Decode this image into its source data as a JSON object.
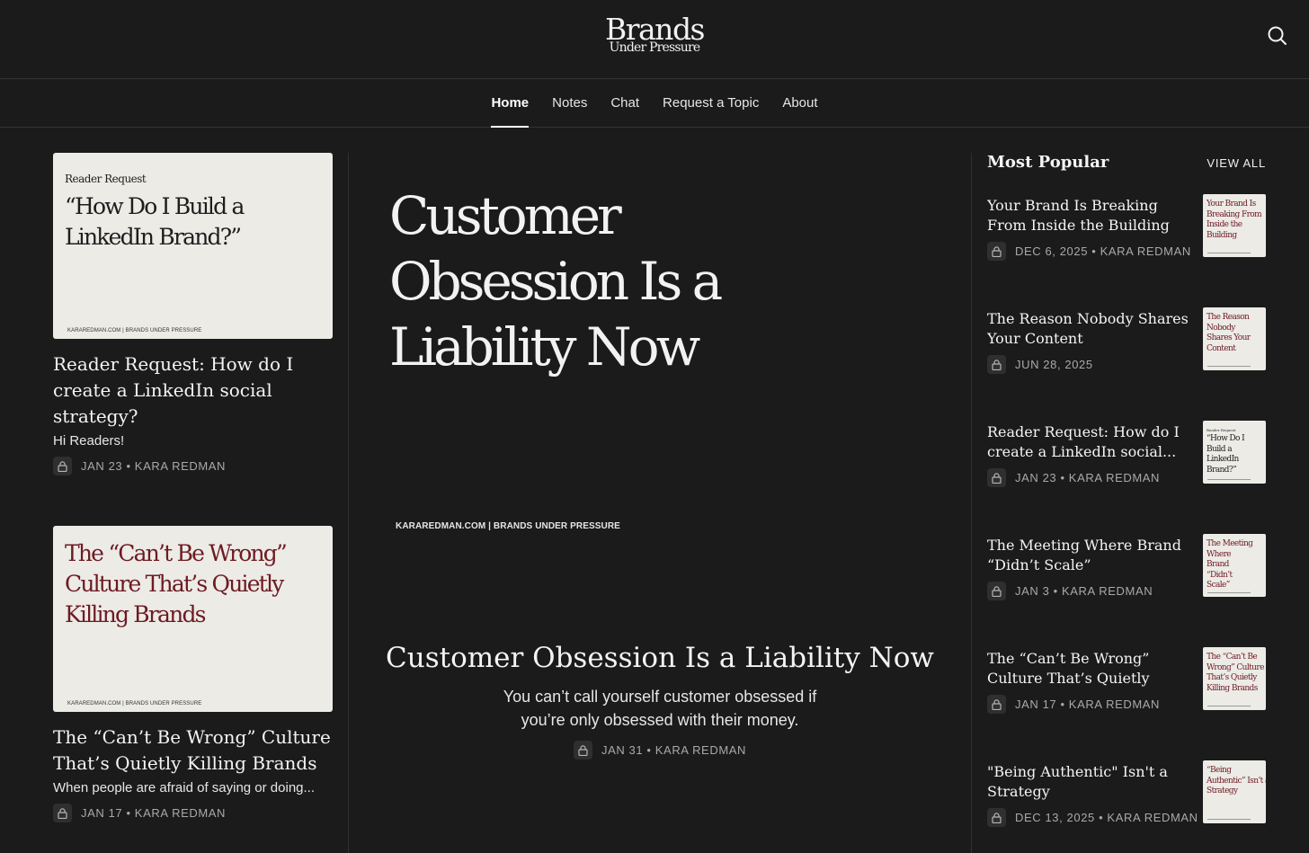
{
  "header": {
    "logo_main": "Brands",
    "logo_sub": "Under Pressure"
  },
  "nav": [
    {
      "label": "Home",
      "active": true
    },
    {
      "label": "Notes",
      "active": false
    },
    {
      "label": "Chat",
      "active": false
    },
    {
      "label": "Request a Topic",
      "active": false
    },
    {
      "label": "About",
      "active": false
    }
  ],
  "left_posts": [
    {
      "thumb_kicker": "Reader Request",
      "thumb_title": "“How Do I Build a LinkedIn Brand?”",
      "thumb_footer": "KARAREDMAN.COM | BRANDS UNDER PRESSURE",
      "title": "Reader Request: How do I create a LinkedIn social strategy?",
      "subtitle": "Hi Readers!",
      "meta": "JAN 23 • KARA REDMAN"
    },
    {
      "thumb_kicker": "",
      "thumb_title": "The “Can’t Be Wrong” Culture That’s Quietly Killing Brands",
      "thumb_footer": "KARAREDMAN.COM | BRANDS UNDER PRESSURE",
      "title": "The “Can’t Be Wrong” Culture That’s Quietly Killing Brands",
      "subtitle": "When people are afraid of saying or doing...",
      "meta": "JAN 17 • KARA REDMAN"
    }
  ],
  "featured": {
    "image_title": "Customer Obsession Is a Liability Now",
    "image_footer": "KARAREDMAN.COM | BRANDS UNDER PRESSURE",
    "title": "Customer Obsession Is a Liability Now",
    "subtitle": "You can’t call yourself customer obsessed if you’re only obsessed with their money.",
    "meta": "JAN 31 • KARA REDMAN"
  },
  "most_popular": {
    "heading": "Most Popular",
    "view_all": "VIEW ALL",
    "items": [
      {
        "title": "Your Brand Is Breaking From Inside the Building",
        "meta": "DEC 6, 2025 • KARA REDMAN",
        "thumb_text": "Your Brand Is Breaking From Inside the Building",
        "thumb_kicker": ""
      },
      {
        "title": "The Reason Nobody Shares Your Content",
        "meta": "JUN 28, 2025",
        "thumb_text": "The Reason Nobody Shares Your Content",
        "thumb_kicker": ""
      },
      {
        "title": "Reader Request: How do I create a LinkedIn social...",
        "meta": "JAN 23 • KARA REDMAN",
        "thumb_text": "“How Do I Build a LinkedIn Brand?”",
        "thumb_kicker": "Reader Request"
      },
      {
        "title": "The Meeting Where Brand “Didn’t Scale”",
        "meta": "JAN 3 • KARA REDMAN",
        "thumb_text": "The Meeting Where Brand “Didn’t Scale”",
        "thumb_kicker": ""
      },
      {
        "title": "The “Can’t Be Wrong” Culture That’s Quietly Killi...",
        "meta": "JAN 17 • KARA REDMAN",
        "thumb_text": "The “Can’t Be Wrong” Culture That’s Quietly Killing Brands",
        "thumb_kicker": ""
      },
      {
        "title": "\"Being Authentic\" Isn't a Strategy",
        "meta": "DEC 13, 2025 • KARA REDMAN",
        "thumb_text": "“Being Authentic” Isn’t a Strategy",
        "thumb_kicker": ""
      }
    ]
  },
  "icons": {
    "search": "search-icon",
    "lock": "lock-icon"
  },
  "colors": {
    "background": "#1b1b1b",
    "thumb_bg": "#ecebe6",
    "thumb_red": "#6e1a22",
    "meta_gray": "#a9a9a9"
  }
}
